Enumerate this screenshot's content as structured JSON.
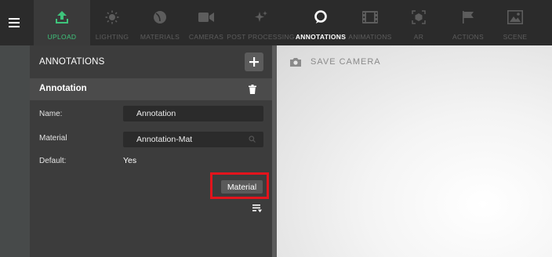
{
  "toolbar": {
    "tabs": [
      {
        "label": "UPLOAD",
        "icon": "upload-icon"
      },
      {
        "label": "LIGHTING",
        "icon": "sun-icon"
      },
      {
        "label": "MATERIALS",
        "icon": "materials-icon"
      },
      {
        "label": "CAMERAS",
        "icon": "video-camera-icon"
      },
      {
        "label": "POST PROCESSING",
        "icon": "sparkles-icon"
      },
      {
        "label": "ANNOTATIONS",
        "icon": "annotation-icon"
      },
      {
        "label": "ANIMATIONS",
        "icon": "film-icon"
      },
      {
        "label": "AR",
        "icon": "ar-cube-icon"
      },
      {
        "label": "ACTIONS",
        "icon": "flag-icon"
      },
      {
        "label": "SCENE",
        "icon": "image-icon"
      }
    ],
    "colors": {
      "upload_active": "#3ec47b",
      "inactive": "#5d5d5d"
    }
  },
  "panel": {
    "title": "ANNOTATIONS",
    "section_title": "Annotation",
    "name_label": "Name:",
    "name_value": "Annotation",
    "material_label": "Material",
    "material_value": "Annotation-Mat",
    "default_label": "Default:",
    "default_value": "Yes",
    "material_button": "Material"
  },
  "viewport": {
    "save_camera": "SAVE CAMERA"
  },
  "highlight_color": "#e3141c"
}
